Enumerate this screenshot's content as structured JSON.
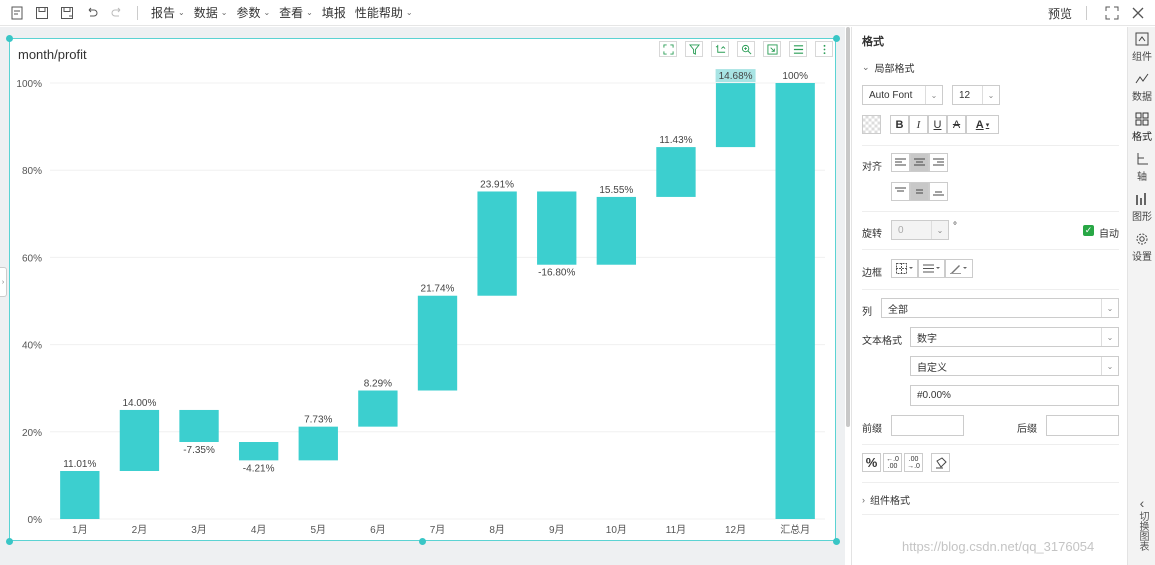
{
  "toolbar": {
    "menus": [
      {
        "label": "报告"
      },
      {
        "label": "数据"
      },
      {
        "label": "参数"
      },
      {
        "label": "查看"
      },
      {
        "label": "填报"
      },
      {
        "label": "性能帮助"
      }
    ],
    "preview_label": "预览"
  },
  "widget": {
    "title": "month/profit"
  },
  "chart_data": {
    "type": "bar",
    "subtype": "waterfall",
    "categories": [
      "1月",
      "2月",
      "3月",
      "4月",
      "5月",
      "6月",
      "7月",
      "8月",
      "9月",
      "10月",
      "11月",
      "12月",
      "汇总月"
    ],
    "values": [
      11.01,
      14.0,
      -7.35,
      -4.21,
      7.73,
      8.29,
      21.74,
      23.91,
      -16.8,
      15.55,
      11.43,
      14.68,
      100
    ],
    "labels": [
      "11.01%",
      "14.00%",
      "-7.35%",
      "-4.21%",
      "7.73%",
      "8.29%",
      "21.74%",
      "23.91%",
      "-16.80%",
      "15.55%",
      "11.43%",
      "14.68%",
      "100%"
    ],
    "highlighted_label_index": 11,
    "total_index": 12,
    "ylim": [
      0,
      100
    ],
    "yticks": [
      "0%",
      "20%",
      "40%",
      "60%",
      "80%",
      "100%"
    ],
    "ytick_values": [
      0,
      20,
      40,
      60,
      80,
      100
    ],
    "grid": true,
    "color": "#3ccfcf",
    "highlight_color": "#a8e4e4"
  },
  "panel": {
    "title": "格式",
    "local_format": "局部格式",
    "font_family": "Auto Font",
    "font_size": "12",
    "align_label": "对齐",
    "rotate_label": "旋转",
    "rotate_value": "0",
    "rotate_unit": "°",
    "auto_label": "自动",
    "border_label": "边框",
    "column_label": "列",
    "column_value": "全部",
    "text_format_label": "文本格式",
    "text_format_value": "数字",
    "custom_value": "自定义",
    "pattern_value": "#0.00%",
    "prefix_label": "前缀",
    "suffix_label": "后缀",
    "component_format": "组件格式"
  },
  "side_strip": {
    "items": [
      {
        "label": "组件"
      },
      {
        "label": "数据"
      },
      {
        "label": "格式"
      },
      {
        "label": "轴"
      },
      {
        "label": "图形"
      },
      {
        "label": "设置"
      }
    ],
    "switch_label": "切换图表"
  },
  "watermark": "https://blog.csdn.net/qq_3176054"
}
